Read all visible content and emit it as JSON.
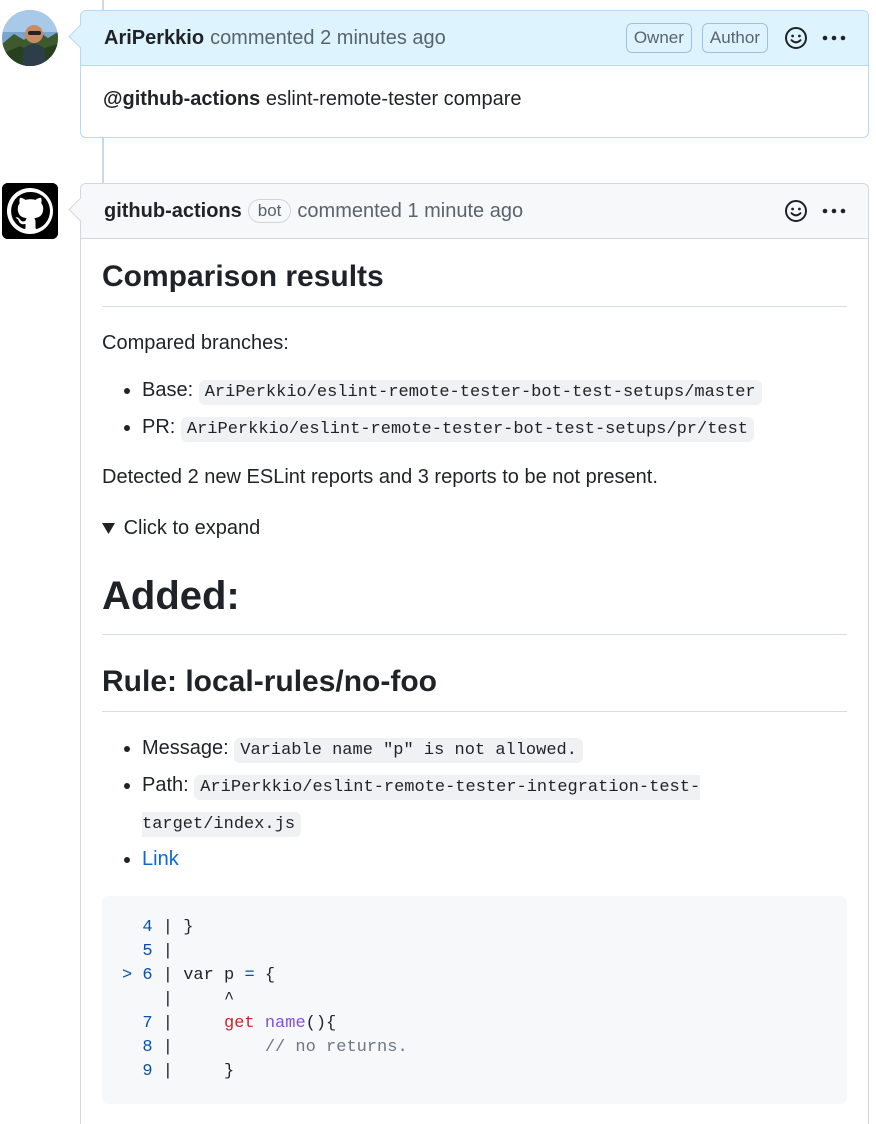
{
  "comment1": {
    "author": "AriPerkkio",
    "action": "commented",
    "time": "2 minutes ago",
    "badges": [
      "Owner",
      "Author"
    ],
    "mention": "@github-actions",
    "text": "eslint-remote-tester compare"
  },
  "comment2": {
    "author": "github-actions",
    "bot_label": "bot",
    "action": "commented",
    "time": "1 minute ago",
    "heading": "Comparison results",
    "compared_label": "Compared branches:",
    "branches": [
      {
        "label": "Base:",
        "value": "AriPerkkio/eslint-remote-tester-bot-test-setups/master"
      },
      {
        "label": "PR:",
        "value": "AriPerkkio/eslint-remote-tester-bot-test-setups/pr/test"
      }
    ],
    "summary": "Detected 2 new ESLint reports and 3 reports to be not present.",
    "expand_label": "Click to expand",
    "added_heading": "Added:",
    "rule_heading": "Rule: local-rules/no-foo",
    "details": [
      {
        "label": "Message:",
        "value": "Variable name \"p\" is not allowed."
      },
      {
        "label": "Path:",
        "value": "AriPerkkio/eslint-remote-tester-integration-test-target/index.js"
      }
    ],
    "link_label": "Link",
    "code_lines": [
      {
        "marker": "  ",
        "num": "4",
        "sep": " | ",
        "code": "}"
      },
      {
        "marker": "  ",
        "num": "5",
        "sep": " |",
        "code": ""
      },
      {
        "marker": "> ",
        "num": "6",
        "sep": " | ",
        "code": "var p = {"
      },
      {
        "marker": "  ",
        "num": " ",
        "sep": " | ",
        "code": "    ^"
      },
      {
        "marker": "  ",
        "num": "7",
        "sep": " | ",
        "code": "    get name(){"
      },
      {
        "marker": "  ",
        "num": "8",
        "sep": " | ",
        "code": "        // no returns."
      },
      {
        "marker": "  ",
        "num": "9",
        "sep": " | ",
        "code": "    }"
      }
    ]
  },
  "colors": {
    "link": "#0969da",
    "line_number": "#0550ae",
    "keyword": "#cf222e",
    "function": "#8250df",
    "comment": "#6e7781"
  },
  "icons": [
    "user-avatar",
    "github-octocat-avatar",
    "smiley-icon",
    "kebab-menu-icon"
  ]
}
